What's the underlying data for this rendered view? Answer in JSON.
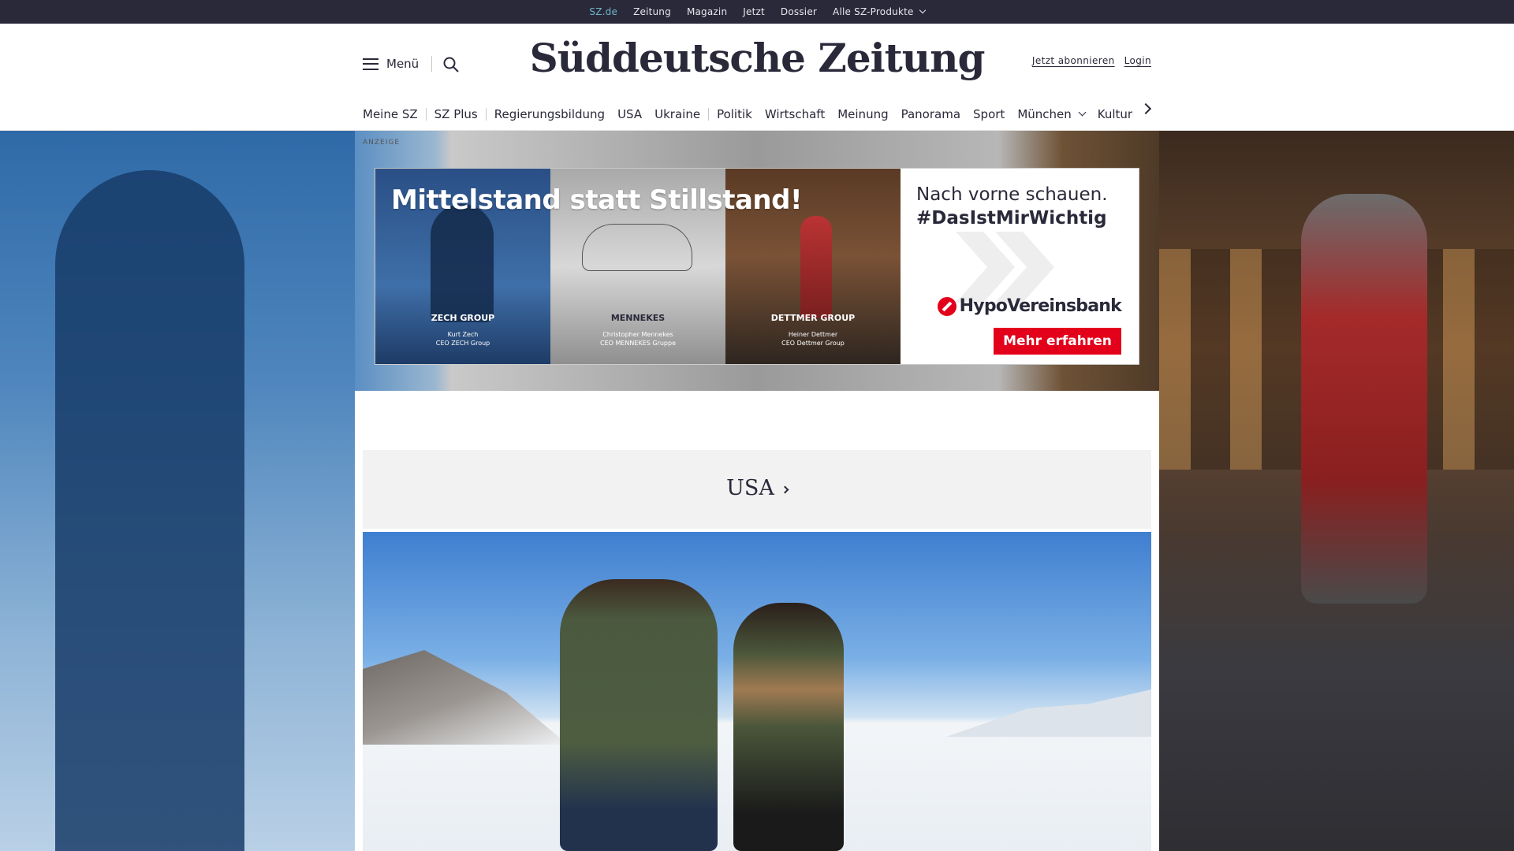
{
  "topbar": {
    "links": [
      "SZ.de",
      "Zeitung",
      "Magazin",
      "Jetzt",
      "Dossier"
    ],
    "products_label": "Alle SZ-Produkte"
  },
  "header": {
    "menu_label": "Menü",
    "logo": "Süddeutsche Zeitung",
    "subscribe_label": "Jetzt abonnieren",
    "login_label": "Login"
  },
  "nav": {
    "items": [
      "Meine SZ",
      "SZ Plus",
      "Regierungsbildung",
      "USA",
      "Ukraine",
      "Politik",
      "Wirtschaft",
      "Meinung",
      "Panorama",
      "Sport",
      "München",
      "Kultur"
    ]
  },
  "ad": {
    "label": "ANZEIGE",
    "headline": "Mittelstand statt Stillstand!",
    "panels": [
      {
        "company": "ZECH GROUP",
        "person": "Kurt Zech",
        "role": "CEO ZECH Group"
      },
      {
        "company": "MENNEKES",
        "person": "Christopher Mennekes",
        "role": "CEO MENNEKES Gruppe"
      },
      {
        "company": "DETTMER GROUP",
        "person": "Heiner Dettmer",
        "role": "CEO Dettmer Group"
      }
    ],
    "tagline1": "Nach vorne schauen.",
    "tagline2": "#DasIstMirWichtig",
    "brand": "HypoVereinsbank",
    "cta": "Mehr erfahren",
    "brand_color": "#e3001b"
  },
  "section": {
    "title": "USA"
  },
  "colors": {
    "topbar_bg": "#29293a",
    "active_link": "#6fb6c9",
    "text": "#29293a"
  }
}
